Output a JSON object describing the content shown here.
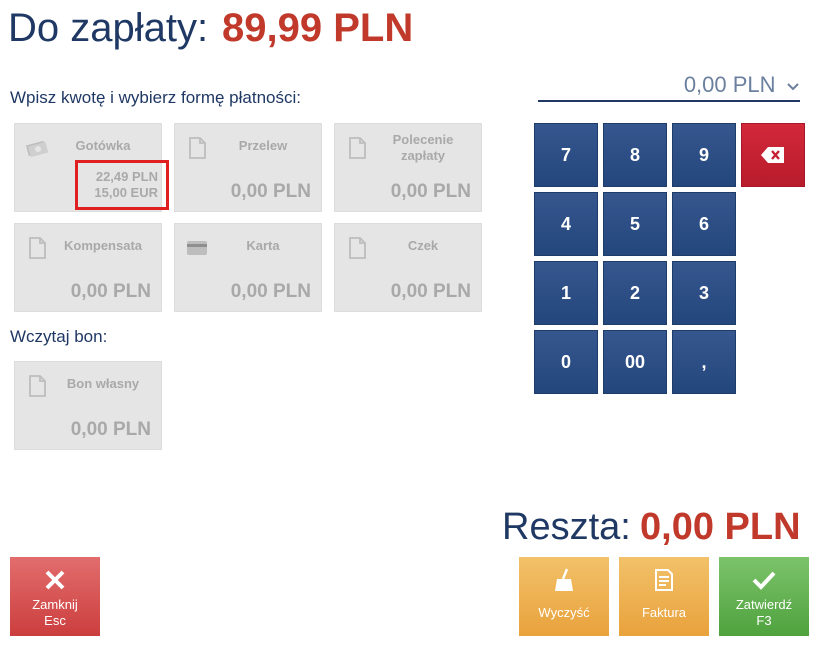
{
  "header": {
    "due_label": "Do zapłaty:",
    "due_amount": "89,99 PLN"
  },
  "instruction": "Wpisz kwotę i wybierz formę płatności:",
  "voucher_label": "Wczytaj bon:",
  "amount_input": {
    "value": "0,00 PLN"
  },
  "tiles": [
    {
      "name": "Gotówka",
      "amount_pln": "22,49 PLN",
      "amount_eur": "15,00 EUR",
      "icon": "cash-icon"
    },
    {
      "name": "Przelew",
      "amount": "0,00 PLN",
      "icon": "document-icon"
    },
    {
      "name": "Polecenie zapłaty",
      "amount": "0,00 PLN",
      "icon": "document-icon"
    },
    {
      "name": "Kompensata",
      "amount": "0,00 PLN",
      "icon": "document-icon"
    },
    {
      "name": "Karta",
      "amount": "0,00 PLN",
      "icon": "card-icon"
    },
    {
      "name": "Czek",
      "amount": "0,00 PLN",
      "icon": "document-icon"
    },
    {
      "name": "Bon własny",
      "amount": "0,00 PLN",
      "icon": "document-icon"
    }
  ],
  "keypad": [
    "7",
    "8",
    "9",
    "4",
    "5",
    "6",
    "1",
    "2",
    "3",
    "0",
    "00",
    ","
  ],
  "change": {
    "label": "Reszta:",
    "amount": "0,00 PLN"
  },
  "buttons": {
    "close": {
      "label": "Zamknij",
      "shortcut": "Esc"
    },
    "clear": {
      "label": "Wyczyść"
    },
    "invoice": {
      "label": "Faktura"
    },
    "confirm": {
      "label": "Zatwierdź",
      "shortcut": "F3"
    }
  },
  "colors": {
    "accent_red": "#c0392b",
    "navy": "#1f3864",
    "key_blue": "#2b4a80",
    "tile_bg": "#e5e5e5"
  }
}
